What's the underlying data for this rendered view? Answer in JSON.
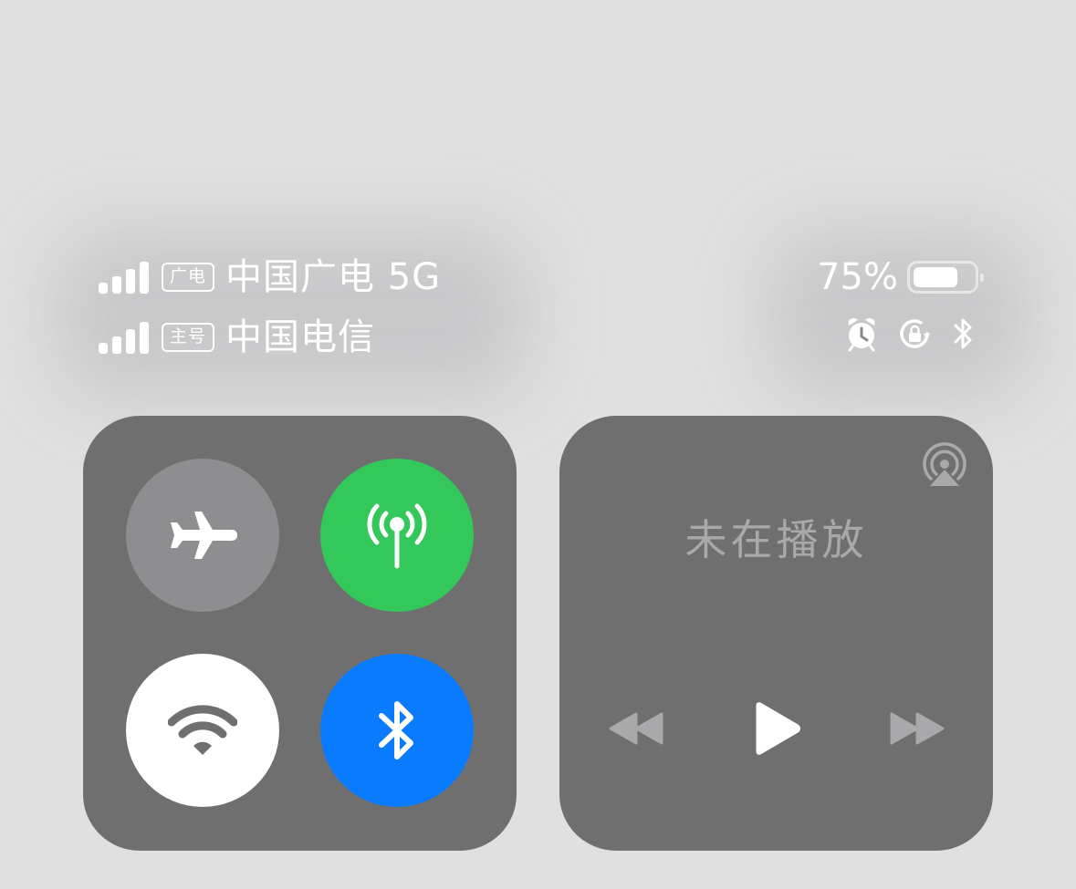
{
  "status_bar": {
    "sim1": {
      "badge": "广电",
      "carrier": "中国广电 5G",
      "signal_bars": 4
    },
    "sim2": {
      "badge": "主号",
      "carrier": "中国电信",
      "signal_bars": 4
    },
    "battery_percent": "75%",
    "battery_level": 0.75,
    "indicators": [
      "alarm-icon",
      "rotation-lock-icon",
      "bluetooth-icon"
    ]
  },
  "connectivity": {
    "airplane": {
      "icon": "airplane-icon",
      "state": "off",
      "color": "#8e8e90"
    },
    "cellular": {
      "icon": "cellular-antenna-icon",
      "state": "on",
      "color": "#34c759"
    },
    "wifi": {
      "icon": "wifi-icon",
      "state": "on",
      "color": "#ffffff"
    },
    "bluetooth": {
      "icon": "bluetooth-icon",
      "state": "on",
      "color": "#0a7aff"
    }
  },
  "media": {
    "status": "未在播放",
    "airplay_icon": "airplay-icon",
    "controls": [
      "rewind-icon",
      "play-icon",
      "fast-forward-icon"
    ]
  },
  "colors": {
    "background": "#e0e0e1",
    "panel": "#6f6f70",
    "muted_text": "#a9a9ab"
  }
}
